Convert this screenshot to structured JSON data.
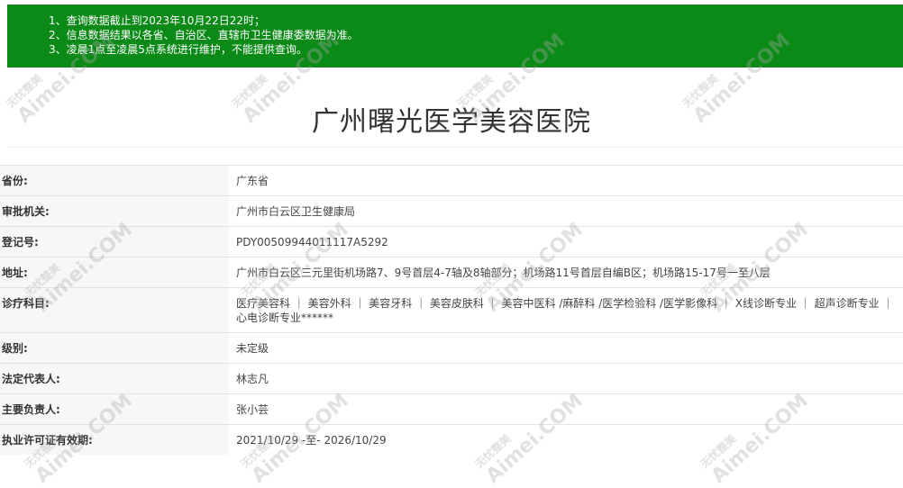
{
  "notice": {
    "lines": [
      "1、查询数据截止到2023年10月22日22时；",
      "2、信息数据结果以各省、自治区、直辖市卫生健康委数据为准。",
      "3、凌晨1点至凌晨5点系统进行维护，不能提供查询。"
    ]
  },
  "hospital": {
    "name": "广州曙光医学美容医院"
  },
  "fields": [
    {
      "label": "省份:",
      "value": "广东省"
    },
    {
      "label": "审批机关:",
      "value": "广州市白云区卫生健康局"
    },
    {
      "label": "登记号:",
      "value": "PDY00509944011117A5292"
    },
    {
      "label": "地址:",
      "value": "广州市白云区三元里街机场路7、9号首层4-7轴及8轴部分；机场路11号首层自编B区；机场路15-17号一至八层"
    },
    {
      "label": "诊疗科目:",
      "value": "医疗美容科 ｜ 美容外科 ｜ 美容牙科 ｜ 美容皮肤科 ｜ 美容中医科 /麻醉科 /医学检验科 /医学影像科 ｜ X线诊断专业 ｜ 超声诊断专业 ｜ 心电诊断专业******"
    },
    {
      "label": "级别:",
      "value": "未定级"
    },
    {
      "label": "法定代表人:",
      "value": "林志凡"
    },
    {
      "label": "主要负责人:",
      "value": "张小芸"
    },
    {
      "label": "执业许可证有效期:",
      "value": "2021/10/29 -至- 2026/10/29"
    }
  ],
  "watermark": {
    "text": "Aimei.COM",
    "cn": "无忧整美"
  },
  "colors": {
    "notice_bg": "#0b8a17",
    "key_bg": "#f7f7f7"
  }
}
